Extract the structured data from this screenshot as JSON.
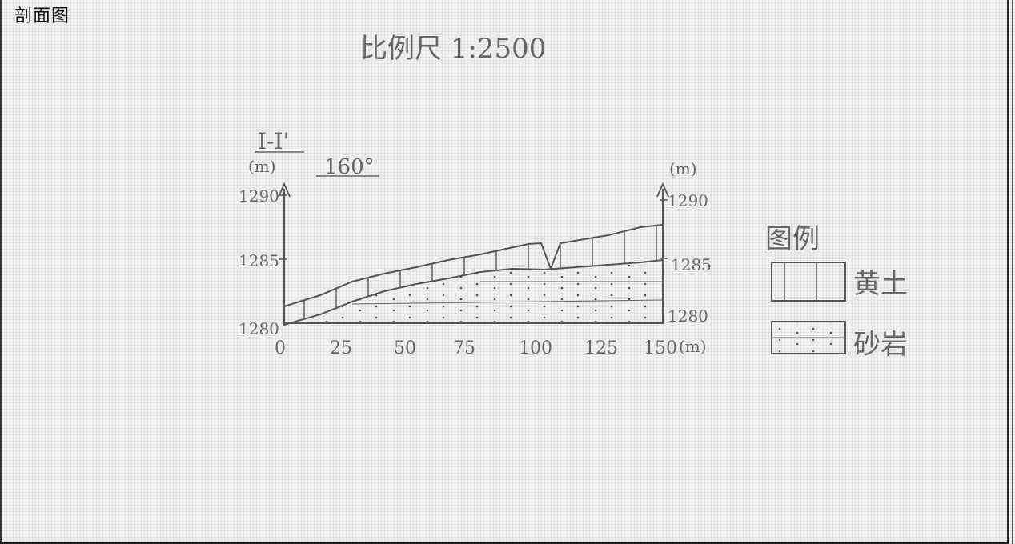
{
  "page_title": "剖面图",
  "scale_text": "比例尺 1:2500",
  "section_label": "I-I'",
  "bearing": "160°",
  "left_axis": {
    "unit": "(m)",
    "ticks": [
      "1290",
      "1285",
      "1280"
    ]
  },
  "right_axis": {
    "unit": "(m)",
    "ticks": [
      "1290",
      "1285",
      "1280"
    ]
  },
  "x_axis": {
    "ticks": [
      "0",
      "25",
      "50",
      "75",
      "100",
      "125",
      "150"
    ],
    "unit": "(m)"
  },
  "legend": {
    "title": "图例",
    "items": [
      {
        "label": "黄土",
        "pattern": "vertical-lines"
      },
      {
        "label": "砂岩",
        "pattern": "dots"
      }
    ]
  },
  "colors": {
    "ink": "#111111",
    "pencil": "#666666",
    "paper": "#eff1ef"
  }
}
